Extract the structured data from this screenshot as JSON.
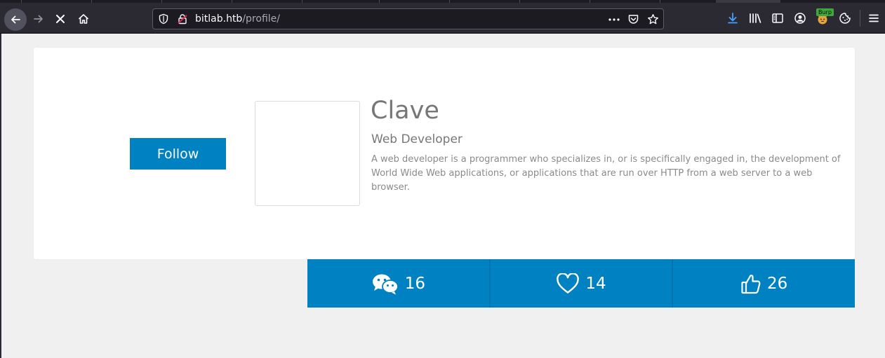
{
  "browser": {
    "url_host": "bitlab.htb",
    "url_path": "/profile/",
    "extension_badge": "Burp"
  },
  "profile": {
    "follow_label": "Follow",
    "name": "Clave",
    "title": "Web Developer",
    "description": "A web developer is a programmer who specializes in, or is specifically engaged in, the development of World Wide Web applications, or applications that are run over HTTP from a web server to a web browser."
  },
  "stats": [
    {
      "icon": "wechat-icon",
      "count": "16"
    },
    {
      "icon": "heart-icon",
      "count": "14"
    },
    {
      "icon": "thumbs-up-icon",
      "count": "26"
    }
  ],
  "colors": {
    "accent": "#0081c2",
    "text_muted": "#777777",
    "page_bg": "#f0f0f0"
  }
}
